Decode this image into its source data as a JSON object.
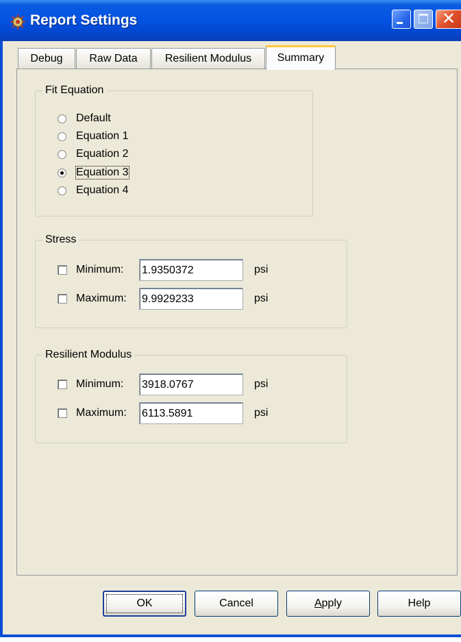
{
  "window": {
    "title": "Report Settings",
    "icon": "app-settings-icon",
    "controls": {
      "minimize": "minimize-icon",
      "maximize": "maximize-icon",
      "close": "close-icon"
    }
  },
  "tabs": [
    {
      "label": "Debug",
      "active": false
    },
    {
      "label": "Raw Data",
      "active": false
    },
    {
      "label": "Resilient Modulus",
      "active": false
    },
    {
      "label": "Summary",
      "active": true
    }
  ],
  "fit_equation": {
    "legend": "Fit Equation",
    "options": [
      {
        "label": "Default",
        "selected": false
      },
      {
        "label": "Equation 1",
        "selected": false
      },
      {
        "label": "Equation 2",
        "selected": false
      },
      {
        "label": "Equation 3",
        "selected": true
      },
      {
        "label": "Equation 4",
        "selected": false
      }
    ]
  },
  "stress": {
    "legend": "Stress",
    "minimum": {
      "label": "Minimum:",
      "checked": false,
      "value": "1.9350372",
      "unit": "psi"
    },
    "maximum": {
      "label": "Maximum:",
      "checked": false,
      "value": "9.9929233",
      "unit": "psi"
    }
  },
  "resilient_modulus": {
    "legend": "Resilient Modulus",
    "minimum": {
      "label": "Minimum:",
      "checked": false,
      "value": "3918.0767",
      "unit": "psi"
    },
    "maximum": {
      "label": "Maximum:",
      "checked": false,
      "value": "6113.5891",
      "unit": "psi"
    }
  },
  "buttons": {
    "ok": "OK",
    "cancel": "Cancel",
    "apply_prefix": "A",
    "apply_rest": "pply",
    "help": "Help"
  },
  "colors": {
    "titlebar": "#0554e3",
    "dialog_background": "#ece9d8",
    "active_tab_highlight": "#ffc83c",
    "close_button": "#e1502d"
  }
}
